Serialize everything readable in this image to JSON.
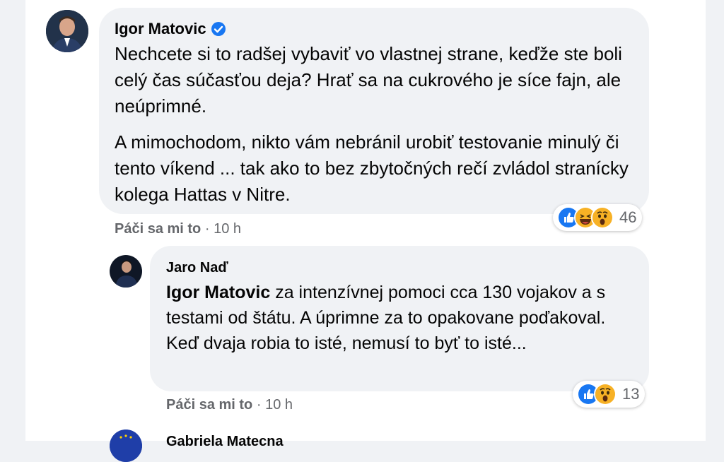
{
  "comments": [
    {
      "author": "Igor Matovic",
      "verified": true,
      "paragraphs": [
        "Nechcete si to radšej vybaviť vo vlastnej strane, keďže ste boli celý čas súčasťou deja? Hrať sa na cukrového je síce fajn, ale neúprimné.",
        "A mimochodom, nikto vám nebránil urobiť testovanie minulý či tento víkend ... tak ako to bez zbytočných rečí zvládol stranícky kolega Hattas v Nitre."
      ],
      "like_label": "Páči sa mi to",
      "separator": "·",
      "time": "10 h",
      "reactions": [
        "like-icon",
        "haha-icon",
        "wow-icon"
      ],
      "reaction_count": "46"
    },
    {
      "author": "Jaro Naď",
      "mention": "Igor Matovic",
      "text": "za intenzívnej pomoci cca 130 vojakov a s testami od štátu. A úprimne za to opakovane poďakoval. Keď dvaja robia to isté, nemusí to byť to isté...",
      "like_label": "Páči sa mi to",
      "separator": "·",
      "time": "10 h",
      "reactions": [
        "like-icon",
        "wow-icon"
      ],
      "reaction_count": "13"
    }
  ],
  "partial_author": "Gabriela Matecna",
  "colors": {
    "page_bg": "#f0f2f5",
    "bubble_bg": "#f0f2f5",
    "like_blue": "#1877f2",
    "emoji_yellow": "#f7b125",
    "secondary_text": "#65676b"
  }
}
